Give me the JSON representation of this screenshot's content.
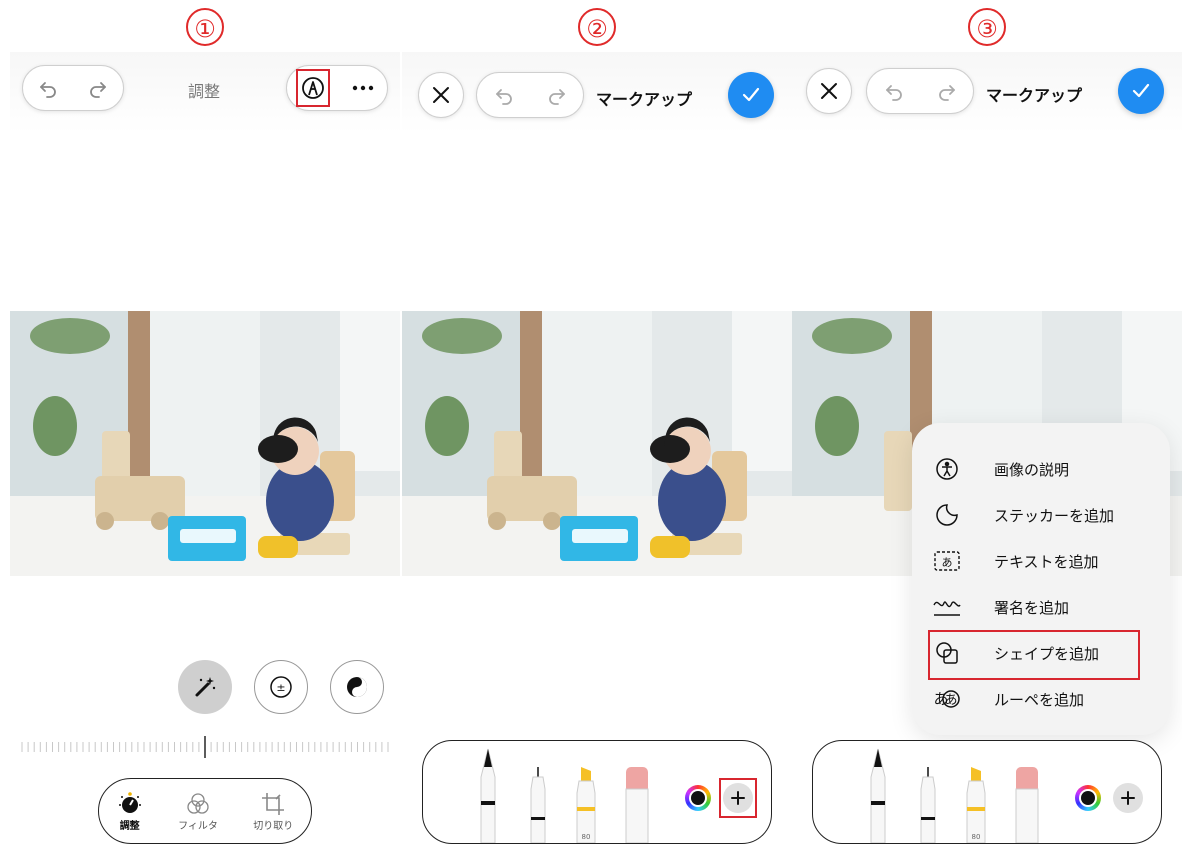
{
  "steps": [
    "①",
    "②",
    "③"
  ],
  "panel1": {
    "title": "調整",
    "tabs": [
      {
        "label": "調整",
        "icon": "dial-icon",
        "active": true
      },
      {
        "label": "フィルタ",
        "icon": "filter-circles-icon",
        "active": false
      },
      {
        "label": "切り取り",
        "icon": "crop-icon",
        "active": false
      }
    ],
    "tools": [
      "auto-magic-wand-icon",
      "exposure-icon",
      "contrast-icon"
    ]
  },
  "panel2": {
    "title": "マークアップ",
    "highlighter_label": "80"
  },
  "panel3": {
    "title": "マークアップ",
    "highlighter_label": "80",
    "menu": [
      {
        "label": "画像の説明",
        "icon": "accessibility-icon"
      },
      {
        "label": "ステッカーを追加",
        "icon": "sticker-icon"
      },
      {
        "label": "テキストを追加",
        "icon": "text-box-icon"
      },
      {
        "label": "署名を追加",
        "icon": "signature-icon"
      },
      {
        "label": "シェイプを追加",
        "icon": "shapes-icon",
        "highlighted": true
      },
      {
        "label": "ルーペを追加",
        "icon": "loupe-icon"
      }
    ]
  },
  "colors": {
    "accent": "#1f8cf2",
    "highlight_box": "#d8262f"
  }
}
